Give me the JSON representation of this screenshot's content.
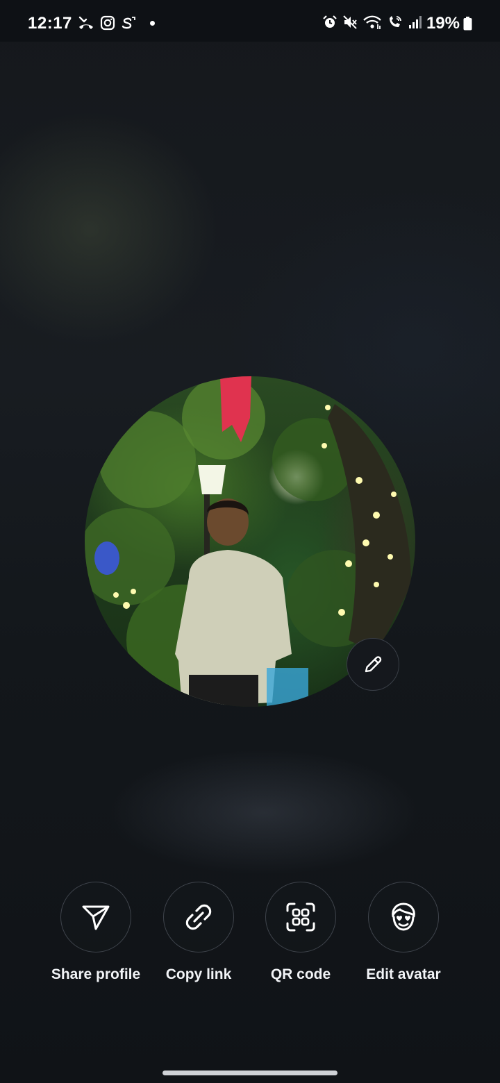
{
  "status_bar": {
    "time": "12:17",
    "battery_percent": "19%",
    "left_icons": [
      "missed-call-icon",
      "instagram-icon",
      "s-app-icon",
      "notification-dot-icon"
    ],
    "right_icons": [
      "alarm-icon",
      "mute-icon",
      "wifi-icon",
      "wifi-call-icon",
      "signal-icon",
      "battery-icon"
    ]
  },
  "profile": {
    "avatar_icon": "profile-photo",
    "edit_icon": "pencil-icon"
  },
  "actions": [
    {
      "label": "Share profile",
      "icon": "send-icon"
    },
    {
      "label": "Copy link",
      "icon": "link-icon"
    },
    {
      "label": "QR code",
      "icon": "qr-code-icon"
    },
    {
      "label": "Edit avatar",
      "icon": "avatar-face-icon"
    }
  ],
  "colors": {
    "background": "#15181c",
    "text": "#ffffff",
    "button_border": "#3f444c"
  }
}
